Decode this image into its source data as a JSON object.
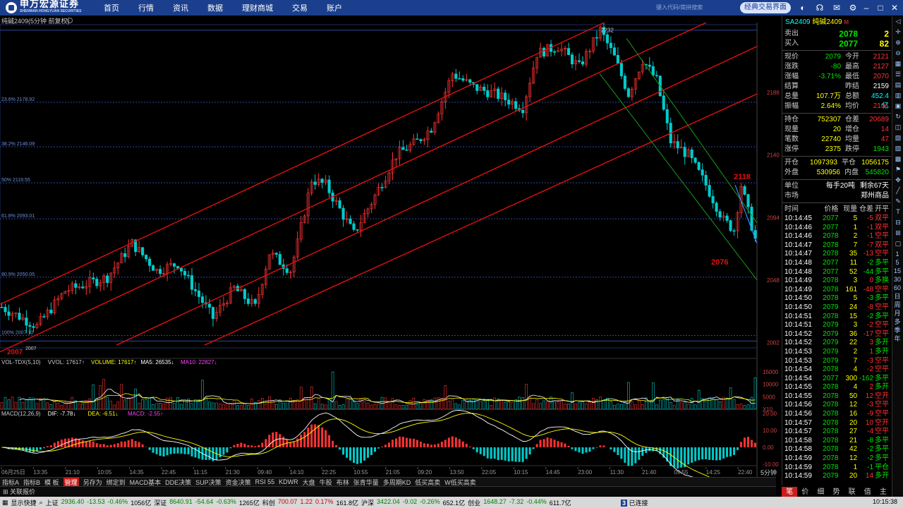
{
  "nav": {
    "brand": "申万宏源证券",
    "brand_sub": "SHENWAN HONGYUAN SECURITIES",
    "items": [
      "首页",
      "行情",
      "资讯",
      "数据",
      "理财商城",
      "交易",
      "账户"
    ],
    "search_placeholder": "键入代码/简拼搜索",
    "classic_btn": "经典交易界面"
  },
  "chart": {
    "title": "纯碱2409(5分钟 前复权)",
    "y_ticks": [
      "2186",
      "2140",
      "2094",
      "2048",
      "2002"
    ],
    "fib_labels": [
      "23.6% 2178.92",
      "38.2% 2146.09",
      "50% 2119.55",
      "61.8% 2093.01",
      "80.9% 2050.05",
      "100% 2007.10"
    ],
    "high_label": "2232",
    "low_label": "2007",
    "low_label_small": "2007",
    "anno_2118": "2118",
    "anno_2076": "2076",
    "x_ticks": [
      "06月25日",
      "13:35",
      "21:10",
      "10:05",
      "14:35",
      "22:45",
      "11:15",
      "21:30",
      "09:40",
      "14:10",
      "22:25",
      "10:55",
      "21:05",
      "09:20",
      "13:50",
      "22:05",
      "10:15",
      "14:45",
      "23:00",
      "11:30",
      "21:40",
      "09:55",
      "14:25",
      "22:40"
    ],
    "period": "5分钟",
    "zoom": "+   -"
  },
  "vol": {
    "label": "VOL-TDX(5,10)",
    "vvol": "VVOL: 17617↑",
    "volume": "VOLUME: 17617↑",
    "ma5": "MA5: 26535↓",
    "ma10": "MA10: 22827↓",
    "y_ticks": [
      "15000",
      "10000",
      "5000",
      "X10"
    ]
  },
  "macd": {
    "label": "MACD(12,26,9)",
    "dif": "DIF: -7.78↓",
    "dea": "DEA: -6.51↓",
    "macd": "MACD: -2.55↑",
    "y_ticks": [
      "20.00",
      "10.00",
      "0.00",
      "-10.00",
      "-20.00"
    ]
  },
  "quote": {
    "code": "SA2409",
    "name": "纯碱2409",
    "mark": "M",
    "sell_lbl": "卖出",
    "sell_price": "2078",
    "sell_vol": "2",
    "buy_lbl": "买入",
    "buy_price": "2077",
    "buy_vol": "82",
    "rows": [
      [
        "现价",
        "2079",
        "今开",
        "2121"
      ],
      [
        "涨跌",
        "-80",
        "最高",
        "2127"
      ],
      [
        "涨幅",
        "-3.71%",
        "最低",
        "2070"
      ],
      [
        "结算",
        "",
        "昨结",
        "2159"
      ],
      [
        "总量",
        "107.7万",
        "总额",
        "452.4亿"
      ],
      [
        "振幅",
        "2.64%",
        "均价",
        "2101"
      ]
    ],
    "rows2": [
      [
        "持仓",
        "752307",
        "仓差",
        "20689"
      ],
      [
        "现量",
        "20",
        "增仓",
        "14"
      ],
      [
        "笔数",
        "22740",
        "均量",
        "47"
      ],
      [
        "涨停",
        "2375",
        "跌停",
        "1943"
      ]
    ],
    "rows3": [
      [
        "开仓",
        "1097393",
        "平仓",
        "1056175"
      ],
      [
        "外盘",
        "530956",
        "内盘",
        "545820"
      ]
    ],
    "unit_lbl": "单位",
    "unit_val": "每手20吨",
    "remain": "剩余67天",
    "market_lbl": "市场",
    "market_val": "郑州商品",
    "tick_headers": [
      "时间",
      "价格",
      "现量",
      "仓差",
      "开平"
    ],
    "ticks": [
      [
        "10:14:45",
        "2077",
        "5",
        "-5",
        "双平"
      ],
      [
        "10:14:46",
        "2077",
        "1",
        "-1",
        "双平"
      ],
      [
        "10:14:46",
        "2078",
        "2",
        "-1",
        "空平"
      ],
      [
        "10:14:47",
        "2078",
        "7",
        "-7",
        "双平"
      ],
      [
        "10:14:47",
        "2078",
        "35",
        "-13",
        "空平"
      ],
      [
        "10:14:48",
        "2077",
        "11",
        "-2",
        "多平"
      ],
      [
        "10:14:48",
        "2077",
        "52",
        "-44",
        "多平"
      ],
      [
        "10:14:49",
        "2078",
        "3",
        "0",
        "多换"
      ],
      [
        "10:14:49",
        "2078",
        "161",
        "-48",
        "空平"
      ],
      [
        "10:14:50",
        "2078",
        "5",
        "-3",
        "多平"
      ],
      [
        "10:14:50",
        "2079",
        "24",
        "-8",
        "空平"
      ],
      [
        "10:14:51",
        "2078",
        "15",
        "-2",
        "多平"
      ],
      [
        "10:14:51",
        "2079",
        "3",
        "-2",
        "空平"
      ],
      [
        "10:14:52",
        "2079",
        "36",
        "-17",
        "空平"
      ],
      [
        "10:14:52",
        "2079",
        "22",
        "3",
        "多开"
      ],
      [
        "10:14:53",
        "2079",
        "2",
        "1",
        "多开"
      ],
      [
        "10:14:53",
        "2079",
        "7",
        "-3",
        "空平"
      ],
      [
        "10:14:54",
        "2078",
        "4",
        "-2",
        "空平"
      ],
      [
        "10:14:54",
        "2077",
        "300",
        "-162",
        "多平"
      ],
      [
        "10:14:55",
        "2078",
        "4",
        "2",
        "多开"
      ],
      [
        "10:14:55",
        "2078",
        "50",
        "12",
        "空开"
      ],
      [
        "10:14:56",
        "2078",
        "12",
        "-3",
        "空平"
      ],
      [
        "10:14:56",
        "2078",
        "16",
        "-9",
        "空平"
      ],
      [
        "10:14:57",
        "2078",
        "20",
        "10",
        "空开"
      ],
      [
        "10:14:57",
        "2078",
        "27",
        "-4",
        "空平"
      ],
      [
        "10:14:58",
        "2078",
        "21",
        "-8",
        "多平"
      ],
      [
        "10:14:58",
        "2078",
        "42",
        "-2",
        "多平"
      ],
      [
        "10:14:59",
        "2078",
        "12",
        "-2",
        "多平"
      ],
      [
        "10:14:59",
        "2078",
        "1",
        "-1",
        "平仓"
      ],
      [
        "10:14:59",
        "2079",
        "20",
        "14",
        "多开"
      ]
    ],
    "bottom_tabs": [
      "笔",
      "价",
      "细",
      "势",
      "联",
      "值",
      "主"
    ]
  },
  "vtoolbar_text": [
    "1",
    "5",
    "15",
    "30",
    "60",
    "日",
    "周",
    "月",
    "多",
    "季",
    "年"
  ],
  "bottom_tabs": [
    "指标A",
    "指标B",
    "模 板",
    "管理",
    "另存为",
    "绑定到",
    "MACD基本",
    "DDE决策",
    "SUP决策",
    "资金决策",
    "RSI 55",
    "KDWR",
    "大盘",
    "牛股",
    "布林",
    "张青华量",
    "多周期KD",
    "低买高卖",
    "W低买高卖"
  ],
  "related": "关联报价",
  "status": {
    "show": "显示快捷",
    "items": [
      {
        "t": "上证",
        "c": ""
      },
      {
        "t": "2936.40",
        "c": "g"
      },
      {
        "t": "-13.53",
        "c": "g"
      },
      {
        "t": "-0.46%",
        "c": "g"
      },
      {
        "t": "1056亿",
        "c": ""
      },
      {
        "t": "深证",
        "c": ""
      },
      {
        "t": "8640.91",
        "c": "g"
      },
      {
        "t": "-54.64",
        "c": "g"
      },
      {
        "t": "-0.63%",
        "c": "g"
      },
      {
        "t": "1265亿",
        "c": ""
      },
      {
        "t": "科创",
        "c": ""
      },
      {
        "t": "700.07",
        "c": "r"
      },
      {
        "t": "1.22",
        "c": "r"
      },
      {
        "t": "0.17%",
        "c": "r"
      },
      {
        "t": "161.8亿",
        "c": ""
      },
      {
        "t": "沪深",
        "c": ""
      },
      {
        "t": "3422.04",
        "c": "g"
      },
      {
        "t": "-9.02",
        "c": "g"
      },
      {
        "t": "-0.26%",
        "c": "g"
      },
      {
        "t": "652.1亿",
        "c": ""
      },
      {
        "t": "创业",
        "c": ""
      },
      {
        "t": "1648.27",
        "c": "g"
      },
      {
        "t": "-7.32",
        "c": "g"
      },
      {
        "t": "-0.44%",
        "c": "g"
      },
      {
        "t": "611.7亿",
        "c": ""
      }
    ],
    "conn": "已连接",
    "time": "10:15:38"
  },
  "colors": {
    "up": "#ff3333",
    "down": "#00e600",
    "accent": "#1b3f8c"
  }
}
